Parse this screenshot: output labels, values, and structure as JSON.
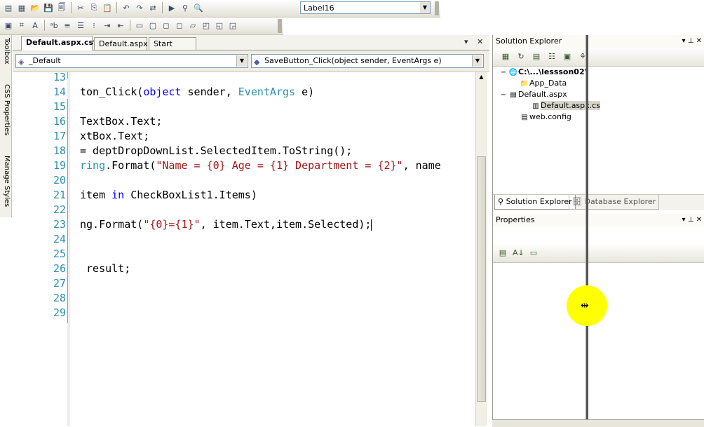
{
  "toolbar": {
    "row1_icons": [
      "new-project-icon",
      "add-item-icon",
      "open-icon",
      "save-icon",
      "save-all-icon",
      "cut-icon",
      "copy-icon",
      "paste-icon",
      "undo-icon",
      "redo-icon",
      "navigate-icon",
      "start-icon",
      "attach-icon",
      "find-icon"
    ],
    "row1_glyphs": [
      "▤",
      "▦",
      "📂",
      "💾",
      "🗐",
      "✂",
      "⎘",
      "📋",
      "↶",
      "↷",
      "⇄",
      "▶",
      "⚲",
      "🔍"
    ],
    "combo_value": "Label16",
    "row2_icons": [
      "properties-icon",
      "format-icon",
      "text-icon",
      "bold-icon",
      "align-left-icon",
      "align-center-icon",
      "list-icon",
      "indent-icon",
      "outdent-icon",
      "box-icon",
      "frame-icon",
      "comment-icon",
      "uncomment-icon",
      "bookmark-icon",
      "bookmark-next-icon",
      "bookmark-prev-icon",
      "clear-bookmark-icon"
    ],
    "row2_glyphs": [
      "▣",
      "⌗",
      "A",
      "ᵃb",
      "≡",
      "☰",
      "⁝",
      "⇥",
      "⇤",
      "▭",
      "▢",
      "◻",
      "◻",
      "▱",
      "◰",
      "◱",
      "◲"
    ]
  },
  "left_strip": {
    "items": [
      "Toolbox",
      "CSS Properties",
      "Manage Styles"
    ]
  },
  "editor_tabs": {
    "tabs": [
      "Default.aspx.cs*",
      "Default.aspx",
      "Start Page"
    ],
    "dropdown_glyph": "▾",
    "close_glyph": "✕"
  },
  "nav": {
    "class_combo": "_Default",
    "member_combo": "SaveButton_Click(object sender, EventArgs e)"
  },
  "editor": {
    "line_numbers": [
      "13",
      "14",
      "15",
      "16",
      "17",
      "18",
      "19",
      "20",
      "21",
      "22",
      "23",
      "24",
      "25",
      "26",
      "27",
      "28",
      "29"
    ],
    "lines": [
      [],
      [
        [
          "t",
          "ton_Click("
        ],
        [
          "kw",
          "object"
        ],
        [
          "t",
          " sender, "
        ],
        [
          "ty",
          "EventArgs"
        ],
        [
          "t",
          " e)"
        ]
      ],
      [],
      [
        [
          "t",
          "TextBox.Text;"
        ]
      ],
      [
        [
          "t",
          "xtBox.Text;"
        ]
      ],
      [
        [
          "t",
          "= deptDropDownList.SelectedItem.ToString();"
        ]
      ],
      [
        [
          "ty",
          "ring"
        ],
        [
          "t",
          ".Format("
        ],
        [
          "st",
          "\"Name = {0} Age = {1} Department = {2}\""
        ],
        [
          "t",
          ", name"
        ]
      ],
      [],
      [
        [
          "t",
          "item "
        ],
        [
          "kw",
          "in"
        ],
        [
          "t",
          " CheckBoxList1.Items)"
        ]
      ],
      [],
      [
        [
          "t",
          "ng.Format("
        ],
        [
          "st",
          "\"{0}={1}\""
        ],
        [
          "t",
          ", item.Text,item.Selected);"
        ]
      ],
      [],
      [],
      [
        [
          "t",
          " result;"
        ]
      ],
      [],
      [],
      []
    ]
  },
  "solution_explorer": {
    "title": "Solution Explorer",
    "pin_glyphs": "▾ ⊥ ✕",
    "tools": [
      "properties-icon",
      "refresh-icon",
      "show-all-icon",
      "view-code-icon",
      "view-designer-icon",
      "copy-website-icon"
    ],
    "tool_glyphs": [
      "▦",
      "↻",
      "▤",
      "☷",
      "▣",
      "⚘"
    ],
    "tree": [
      {
        "label": "C:\\...\\lessson02\\",
        "bold": true,
        "glyph": "🌐",
        "expander": "−"
      },
      {
        "label": "App_Data",
        "bold": false,
        "glyph": "📁",
        "expander": ""
      },
      {
        "label": "Default.aspx",
        "bold": false,
        "glyph": "▤",
        "expander": "−"
      },
      {
        "label": "Default.aspx.cs",
        "bold": false,
        "glyph": "▥",
        "expander": "",
        "selected": true
      },
      {
        "label": "web.config",
        "bold": false,
        "glyph": "▤",
        "expander": ""
      }
    ],
    "bottom_tabs": [
      "Solution Explorer",
      "Database Explorer"
    ]
  },
  "properties": {
    "title": "Properties",
    "pin_glyphs": "▾ ⊥ ✕",
    "tools": [
      "categorized-icon",
      "alphabetical-icon",
      "property-pages-icon"
    ],
    "tool_glyphs": [
      "▤",
      "A↓",
      "▭"
    ]
  },
  "colors": {
    "keyword": "#0000ff",
    "type": "#2b91af",
    "string": "#a31515",
    "line_number": "#2b91af",
    "highlight": "#ffff00"
  }
}
